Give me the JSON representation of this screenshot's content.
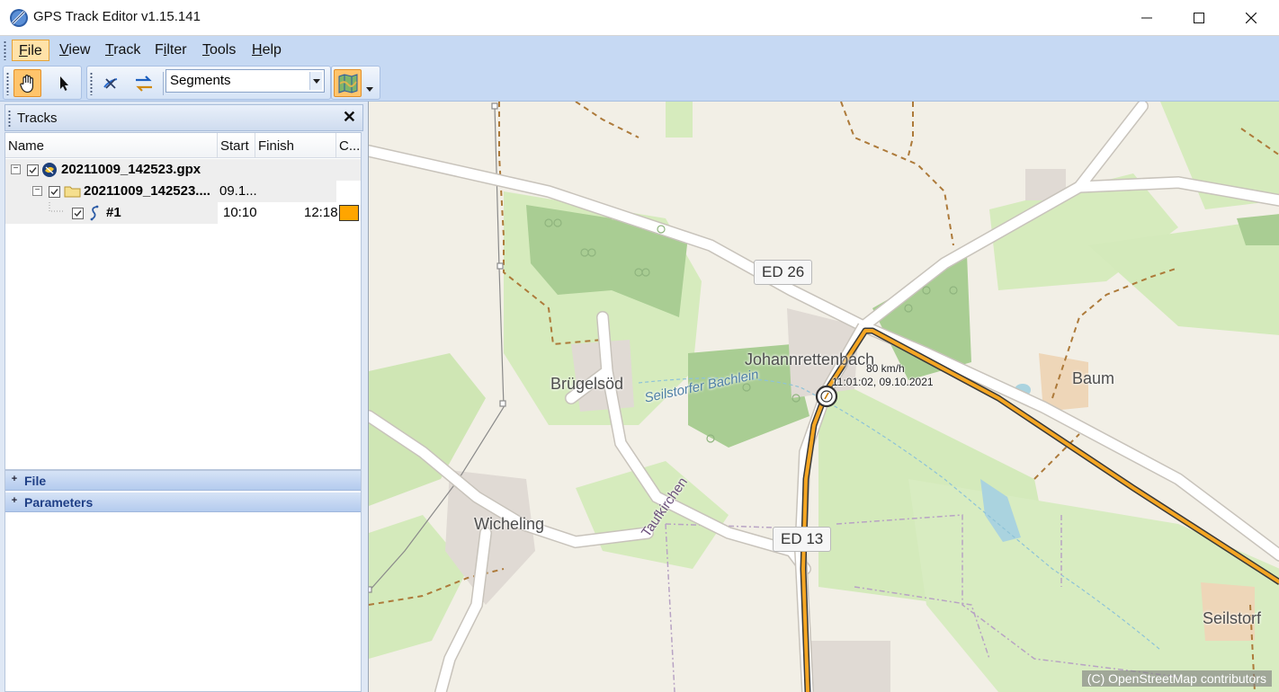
{
  "window": {
    "title": "GPS Track Editor v1.15.141",
    "minimize_icon": "minimize-icon",
    "maximize_icon": "maximize-icon",
    "close_icon": "close-icon"
  },
  "menu": {
    "items": [
      {
        "label": "File",
        "accel": "F",
        "rest": "ile",
        "active": true
      },
      {
        "label": "View",
        "accel": "V",
        "rest": "iew"
      },
      {
        "label": "Track",
        "accel": "T",
        "rest": "rack"
      },
      {
        "label": "Filter",
        "pre": "F",
        "accel": "i",
        "rest": "lter"
      },
      {
        "label": "Tools",
        "accel": "T",
        "rest": "ools"
      },
      {
        "label": "Help",
        "accel": "H",
        "rest": "elp"
      }
    ]
  },
  "toolbar": {
    "hand_tool_icon": "hand-pan-icon",
    "pointer_tool_icon": "pointer-arrow-icon",
    "remove_points_icon": "remove-points-icon",
    "swap_icon": "swap-arrows-icon",
    "segment_mode": "Segments",
    "map_icon": "map-icon"
  },
  "tracks_panel": {
    "title": "Tracks",
    "columns": [
      "Name",
      "Start",
      "Finish",
      "C..."
    ],
    "rows": [
      {
        "name": "20211009_142523.gpx",
        "start": "",
        "finish": "",
        "type": "file"
      },
      {
        "name": "20211009_142523....",
        "start": "09.1...",
        "finish": "",
        "type": "folder"
      },
      {
        "name": "#1",
        "start": "10:10",
        "finish": "12:18",
        "type": "segment",
        "color": "#ffa500"
      }
    ]
  },
  "sections": {
    "file": "File",
    "parameters": "Parameters"
  },
  "map": {
    "labels": {
      "ed26": "ED 26",
      "ed13": "ED 13",
      "johannrettenbach": "Johannrettenbach",
      "bruegelsoed": "Brügelsöd",
      "baum": "Baum",
      "wicheling": "Wicheling",
      "seilstorf": "Seilstorf",
      "taufkirchen": "Taufkirchen",
      "stream": "Seilstorfer Bachlein"
    },
    "track_marker": {
      "speed": "80 km/h",
      "timestamp": "11:01:02, 09.10.2021"
    },
    "attribution": "(C) OpenStreetMap contributors",
    "track_color": "#f5a623"
  }
}
